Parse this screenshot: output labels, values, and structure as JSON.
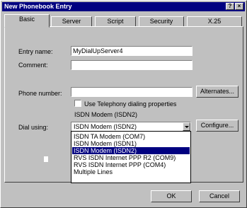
{
  "window": {
    "title": "New Phonebook Entry",
    "help_glyph": "?",
    "close_glyph": "×"
  },
  "tabs": [
    "Basic",
    "Server",
    "Script",
    "Security",
    "X.25"
  ],
  "form": {
    "entry_name_label": "Entry name:",
    "entry_name_value": "MyDialUpServer4",
    "comment_label": "Comment:",
    "comment_value": "",
    "phone_label": "Phone number:",
    "phone_value": "",
    "alternates_button": "Alternates...",
    "telephony_checkbox_label": "Use Telephony dialing properties",
    "telephony_checked": false,
    "device_caption": "ISDN Modem (ISDN2)",
    "dial_using_label": "Dial using:",
    "dial_using_value": "ISDN Modem (ISDN2)",
    "configure_button": "Configure...",
    "dial_options": [
      "ISDN TA Modem (COM7)",
      "ISDN Modem (ISDN1)",
      "ISDN Modem (ISDN2)",
      "RVS ISDN Internet PPP R2 (COM9)",
      "RVS ISDN Internet PPP (COM4)",
      "Multiple Lines"
    ],
    "selected_option_index": 2
  },
  "footer": {
    "ok": "OK",
    "cancel": "Cancel"
  }
}
